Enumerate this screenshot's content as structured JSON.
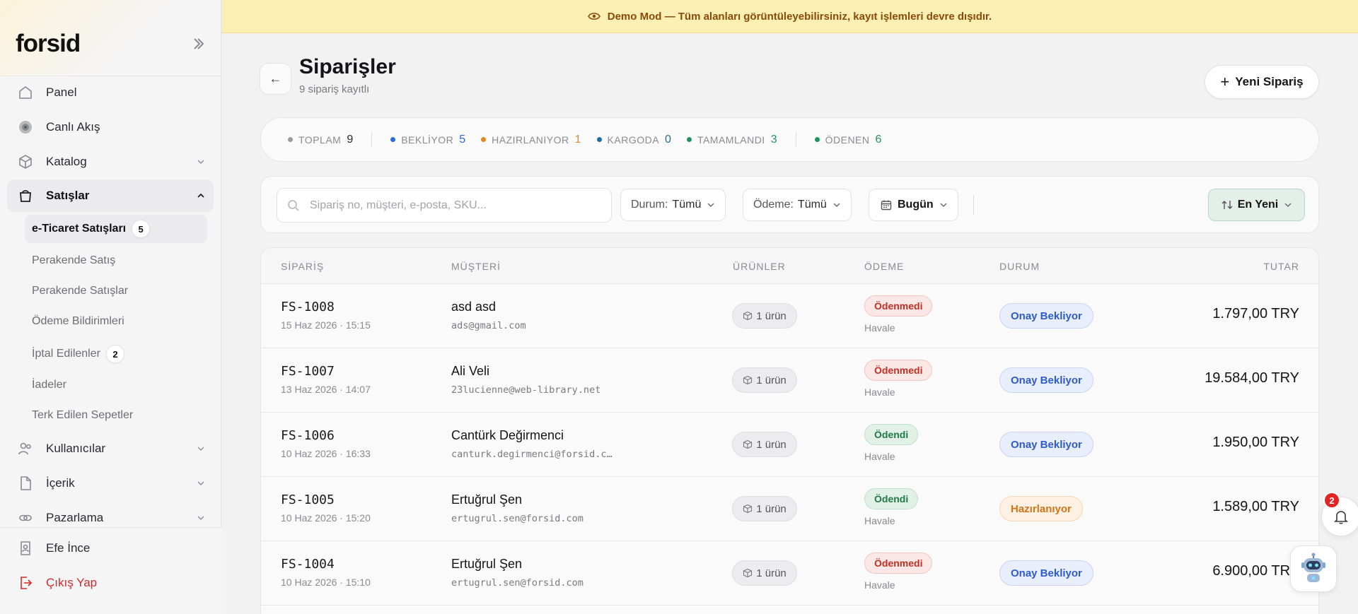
{
  "brand": {
    "logo": "forsid"
  },
  "banner": {
    "text": "Demo Mod — Tüm alanları görüntüleyebilirsiniz, kayıt işlemleri devre dışıdır."
  },
  "sidebar": {
    "items": [
      {
        "label": "Panel",
        "icon": "dashboard-icon"
      },
      {
        "label": "Canlı Akış",
        "icon": "live-icon"
      },
      {
        "label": "Katalog",
        "icon": "box-icon"
      },
      {
        "label": "Satışlar",
        "icon": "bag-icon"
      }
    ],
    "sub_items": [
      {
        "label": "e-Ticaret Satışları",
        "badge": "5"
      },
      {
        "label": "Perakende Satış"
      },
      {
        "label": "Perakende Satışlar"
      },
      {
        "label": "Ödeme Bildirimleri"
      },
      {
        "label": "İptal Edilenler",
        "badge": "2"
      },
      {
        "label": "İadeler"
      },
      {
        "label": "Terk Edilen Sepetler"
      }
    ],
    "items_after": [
      {
        "label": "Kullanıcılar",
        "icon": "users-icon"
      },
      {
        "label": "İçerik",
        "icon": "document-icon"
      },
      {
        "label": "Pazarlama",
        "icon": "link-icon"
      }
    ],
    "user": "Efe İnce",
    "logout": "Çıkış Yap"
  },
  "header": {
    "title": "Siparişler",
    "subtitle": "9 sipariş kayıtlı",
    "new_button": "Yeni Sipariş"
  },
  "stats": [
    {
      "label": "TOPLAM",
      "value": "9",
      "color": "#9a9aa1"
    },
    {
      "label": "BEKLİYOR",
      "value": "5",
      "color": "#2f6bd8"
    },
    {
      "label": "HAZIRLANIYOR",
      "value": "1",
      "color": "#e08a1e"
    },
    {
      "label": "KARGODA",
      "value": "0",
      "color": "#1d6e9e"
    },
    {
      "label": "TAMAMLANDI",
      "value": "3",
      "color": "#1f9460"
    },
    {
      "label": "ÖDENEN",
      "value": "6",
      "color": "#1f9460"
    }
  ],
  "filters": {
    "search_placeholder": "Sipariş no, müşteri, e-posta, SKU...",
    "status_label": "Durum:",
    "status_value": "Tümü",
    "payment_label": "Ödeme:",
    "payment_value": "Tümü",
    "date_value": "Bugün",
    "sort_value": "En Yeni"
  },
  "table": {
    "headers": {
      "order": "SİPARİŞ",
      "customer": "MÜŞTERİ",
      "products": "ÜRÜNLER",
      "payment": "ÖDEME",
      "status": "DURUM",
      "total": "TUTAR"
    },
    "rows": [
      {
        "no": "FS-1008",
        "date": "15 Haz 2026 · 15:15",
        "name": "asd asd",
        "email": "ads@gmail.com",
        "products": "1 ürün",
        "payment": "Ödenmedi",
        "paid": false,
        "method": "Havale",
        "status": "Onay Bekliyor",
        "status_kind": "wait",
        "amount": "1.797,00 TRY"
      },
      {
        "no": "FS-1007",
        "date": "13 Haz 2026 · 14:07",
        "name": "Ali Veli",
        "email": "23lucienne@web-library.net",
        "products": "1 ürün",
        "payment": "Ödenmedi",
        "paid": false,
        "method": "Havale",
        "status": "Onay Bekliyor",
        "status_kind": "wait",
        "amount": "19.584,00 TRY"
      },
      {
        "no": "FS-1006",
        "date": "10 Haz 2026 · 16:33",
        "name": "Cantürk Değirmenci",
        "email": "canturk.degirmenci@forsid.c…",
        "products": "1 ürün",
        "payment": "Ödendi",
        "paid": true,
        "method": "Havale",
        "status": "Onay Bekliyor",
        "status_kind": "wait",
        "amount": "1.950,00 TRY"
      },
      {
        "no": "FS-1005",
        "date": "10 Haz 2026 · 15:20",
        "name": "Ertuğrul Şen",
        "email": "ertugrul.sen@forsid.com",
        "products": "1 ürün",
        "payment": "Ödendi",
        "paid": true,
        "method": "Havale",
        "status": "Hazırlanıyor",
        "status_kind": "prep",
        "amount": "1.589,00 TRY"
      },
      {
        "no": "FS-1004",
        "date": "10 Haz 2026 · 15:10",
        "name": "Ertuğrul Şen",
        "email": "ertugrul.sen@forsid.com",
        "products": "1 ürün",
        "payment": "Ödenmedi",
        "paid": false,
        "method": "Havale",
        "status": "Onay Bekliyor",
        "status_kind": "wait",
        "amount": "6.900,00 TRY"
      }
    ]
  },
  "notifications": {
    "count": "2"
  }
}
